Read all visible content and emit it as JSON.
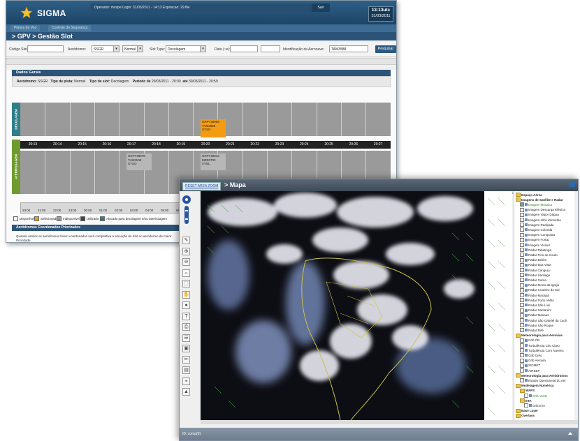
{
  "gpv": {
    "logo": "SIGMA",
    "info_bar": "Operador: mvspe Login: 31/03/2011 - 14:13 Expiracao: 29 file",
    "logout": "Sair",
    "clock_time": "13:13utc",
    "clock_date": "31/03/2011",
    "nav_tabs": [
      "Planos de Voo",
      "Controle de Segurança"
    ],
    "page_title": "> GPV > Gestão Slot",
    "filter": {
      "codigo_slot_label": "Código Slot:",
      "aerodromo_label": "Aeródromo:",
      "aerodromo_value": "SSGR",
      "pista_value": "Normal",
      "slot_type_label": "Slot Type:",
      "slot_type_value": "Decolagem",
      "data_label": "Data (~e):",
      "id_label": "Identificação da Aeronave:",
      "id_value": "TAM3588",
      "search_button": "Pesquisar"
    },
    "panel_title": "Dados Gerais",
    "summary": {
      "aerodromo_label": "Aeródromo:",
      "aerodromo_value": "SSGR",
      "pista_label": "Tipo de pista:",
      "pista_value": "Normal",
      "slot_label": "Tipo de slot:",
      "slot_value": "Decolagem",
      "periodo_label": "Período de",
      "periodo_value": "29/03/2011 - 20:00",
      "ate_label": "até",
      "ate_value": "30/03/2011 - 20:59"
    },
    "side_top": "DECOLAGEM",
    "side_bottom": "ATERRISSAGEM",
    "times": [
      "20:13",
      "20:14",
      "20:15",
      "20:16",
      "20:17",
      "20:18",
      "20:19",
      "20:20",
      "20:21",
      "20:22",
      "20:23",
      "20:24",
      "20:25",
      "20:26",
      "20:27"
    ],
    "slot_dec": {
      "code": "GRP748999",
      "flight": "TAM3588",
      "dest": "SYSO"
    },
    "slot_atr1": {
      "code": "GRP748978",
      "flight": "TAM3108",
      "dest": "SYSO"
    },
    "slot_atr2": {
      "code": "GRP748913",
      "flight": "MZE0703",
      "dest": "SYNL"
    },
    "mini_times": [
      "20:00",
      "21:00",
      "22:00",
      "23:00",
      "00:00",
      "01:00",
      "02:00",
      "03:00",
      "04:00",
      "05:00",
      "06:00"
    ],
    "legend": [
      "Disponível",
      "Selecionado",
      "Indisponível",
      "Utilizado",
      "Alocado para decolagem e/ou aterrissagem"
    ],
    "legend_colors": [
      "#ffffff",
      "#f39c12",
      "#9a9a9a",
      "#444444",
      "#2e7f88"
    ],
    "coord_title": "Aeródromos Coordenados Priorizados",
    "coord_note_1": "Quando ambos os aeródromos forem coordenados será competitiva a alocação do Slot no aeródromo de maior",
    "coord_note_2": "Prioridade"
  },
  "mapa": {
    "link": "RESET AREA ZOOM",
    "title": "> Mapa",
    "readout": "-45.76985, -23.50485",
    "tree": [
      {
        "label": "Espaço Aéreo",
        "kind": "folder",
        "indent": 0,
        "head": true
      },
      {
        "label": "Imagens de Satélite e Radar",
        "kind": "folder",
        "indent": 0,
        "head": true
      },
      {
        "label": "Imagem Mosaico",
        "kind": "layer",
        "indent": 1,
        "checked": true,
        "green": true
      },
      {
        "label": "Imagem Descarga Elétrica",
        "kind": "layer",
        "indent": 1
      },
      {
        "label": "Imagem Vapor Dágua",
        "kind": "layer",
        "indent": 1
      },
      {
        "label": "Imagem Infra Vermelha",
        "kind": "layer",
        "indent": 1
      },
      {
        "label": "Imagem Realçada",
        "kind": "layer",
        "indent": 1
      },
      {
        "label": "Imagem Colorida",
        "kind": "layer",
        "indent": 1
      },
      {
        "label": "Imagem Composta",
        "kind": "layer",
        "indent": 1
      },
      {
        "label": "Imagem Fortaz",
        "kind": "layer",
        "indent": 1
      },
      {
        "label": "Imagem Visível",
        "kind": "layer",
        "indent": 1
      },
      {
        "label": "Radar Tabatinga",
        "kind": "layer",
        "indent": 1
      },
      {
        "label": "Radar Pico do Couto",
        "kind": "layer",
        "indent": 1
      },
      {
        "label": "Radar Belém",
        "kind": "layer",
        "indent": 1
      },
      {
        "label": "Radar Boa Vista",
        "kind": "layer",
        "indent": 1
      },
      {
        "label": "Radar Canguçu",
        "kind": "layer",
        "indent": 1
      },
      {
        "label": "Radar Santiago",
        "kind": "layer",
        "indent": 1
      },
      {
        "label": "Radar Gama",
        "kind": "layer",
        "indent": 1
      },
      {
        "label": "Radar Morro da Igreja",
        "kind": "layer",
        "indent": 1
      },
      {
        "label": "Radar Cruzeiro do Sul",
        "kind": "layer",
        "indent": 1
      },
      {
        "label": "Radar Macapá",
        "kind": "layer",
        "indent": 1
      },
      {
        "label": "Radar Porto Velho",
        "kind": "layer",
        "indent": 1
      },
      {
        "label": "Radar São Luis",
        "kind": "layer",
        "indent": 1
      },
      {
        "label": "Radar Santarém",
        "kind": "layer",
        "indent": 1
      },
      {
        "label": "Radar Manaus",
        "kind": "layer",
        "indent": 1
      },
      {
        "label": "Radar São Gabriel da Cach",
        "kind": "layer",
        "indent": 1
      },
      {
        "label": "Radar São Roque",
        "kind": "layer",
        "indent": 1
      },
      {
        "label": "Radar Tefé",
        "kind": "layer",
        "indent": 1
      },
      {
        "label": "Meteorologia para Aerovias",
        "kind": "folder",
        "indent": 0,
        "head": true
      },
      {
        "label": "Grib CB",
        "kind": "layer",
        "indent": 1
      },
      {
        "label": "Turbulência Céu Claro",
        "kind": "layer",
        "indent": 1
      },
      {
        "label": "Turbulência Com Nuvens",
        "kind": "layer",
        "indent": 1
      },
      {
        "label": "Grib Gelo",
        "kind": "layer",
        "indent": 1
      },
      {
        "label": "Grib Aerovia",
        "kind": "layer",
        "indent": 1
      },
      {
        "label": "SIGMET",
        "kind": "layer",
        "indent": 1
      },
      {
        "label": "AIRSEP",
        "kind": "layer",
        "indent": 1
      },
      {
        "label": "Meteorologia para Aeródromos",
        "kind": "folder",
        "indent": 0,
        "head": true
      },
      {
        "label": "Estado Operacional do Aer",
        "kind": "layer",
        "indent": 1
      },
      {
        "label": "Modelagem Numérica",
        "kind": "folder",
        "indent": 0,
        "head": true
      },
      {
        "label": "WAFS",
        "kind": "folder",
        "indent": 1,
        "head": true
      },
      {
        "label": "Grib Vento",
        "kind": "layer",
        "indent": 2,
        "green": true
      },
      {
        "label": "ETA",
        "kind": "folder",
        "indent": 1,
        "head": true
      },
      {
        "label": "Grib ETA",
        "kind": "layer",
        "indent": 2
      },
      {
        "label": "Base Layer",
        "kind": "folder",
        "indent": 0,
        "head": true
      },
      {
        "label": "Overlays",
        "kind": "folder",
        "indent": 0,
        "head": true
      }
    ],
    "tools": [
      "pan-icon",
      "zoom-in-icon",
      "zoom-out-icon",
      "measure-icon",
      "select-icon",
      "info-icon",
      "ruler-icon",
      "hand-icon",
      "location-icon",
      "text-icon",
      "print-icon",
      "layers-icon",
      "draw-icon",
      "doc-icon",
      "export-icon"
    ],
    "footer": "ID: comp(0)"
  }
}
